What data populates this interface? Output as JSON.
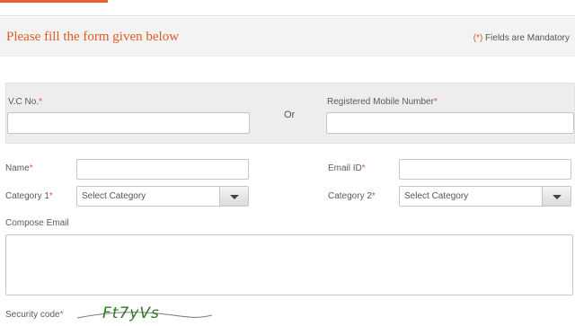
{
  "header": {
    "title": "Please fill the form given below",
    "mandatory_star": "(*)",
    "mandatory_text": " Fields are Mandatory"
  },
  "id_panel": {
    "vc_label": "V.C No.",
    "or_text": "Or",
    "mobile_label": "Registered Mobile Number"
  },
  "form": {
    "required_mark": "*",
    "name_label": "Name",
    "email_label": "Email ID",
    "category1_label": "Category 1",
    "category1_value": "Select Category",
    "category2_label": "Category 2",
    "category2_value": "Select Category",
    "compose_label": "Compose Email",
    "security_label": "Security code",
    "captcha_text": "Ft7yVs"
  },
  "colors": {
    "accent": "#e05a22",
    "required": "#d9534f",
    "captcha": "#2b7a1e"
  }
}
